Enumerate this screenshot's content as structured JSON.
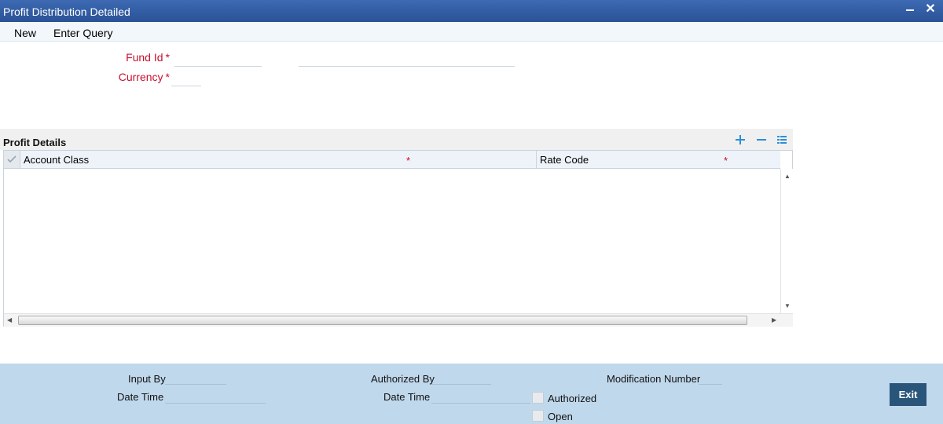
{
  "window": {
    "title": "Profit Distribution Detailed",
    "close_glyph": "✕"
  },
  "menu": {
    "new_label": "New",
    "enter_query_label": "Enter Query"
  },
  "form": {
    "fund_id_label": "Fund Id",
    "currency_label": "Currency",
    "required_marker": "*",
    "fund_id_value": "",
    "fund_description_value": "",
    "currency_value": ""
  },
  "profit_details": {
    "title": "Profit Details",
    "columns": [
      {
        "label": "Account Class",
        "required": true
      },
      {
        "label": "Rate Code",
        "required": true
      }
    ],
    "rows": []
  },
  "footer": {
    "input_by_label": "Input By",
    "date_time_label_1": "Date Time",
    "authorized_by_label": "Authorized By",
    "date_time_label_2": "Date Time",
    "modification_number_label": "Modification Number",
    "authorized_label": "Authorized",
    "open_label": "Open",
    "authorized_checked": false,
    "open_checked": false,
    "exit_label": "Exit"
  },
  "colors": {
    "titlebar": "#2a5296",
    "required": "#c8102e",
    "footer": "#c0d8ec",
    "accent_icon": "#2b8fd8",
    "exit_button": "#2a557a"
  },
  "icons": [
    "minimize-icon",
    "close-icon",
    "add-row-icon",
    "delete-row-icon",
    "single-view-icon",
    "select-all-check-icon"
  ]
}
